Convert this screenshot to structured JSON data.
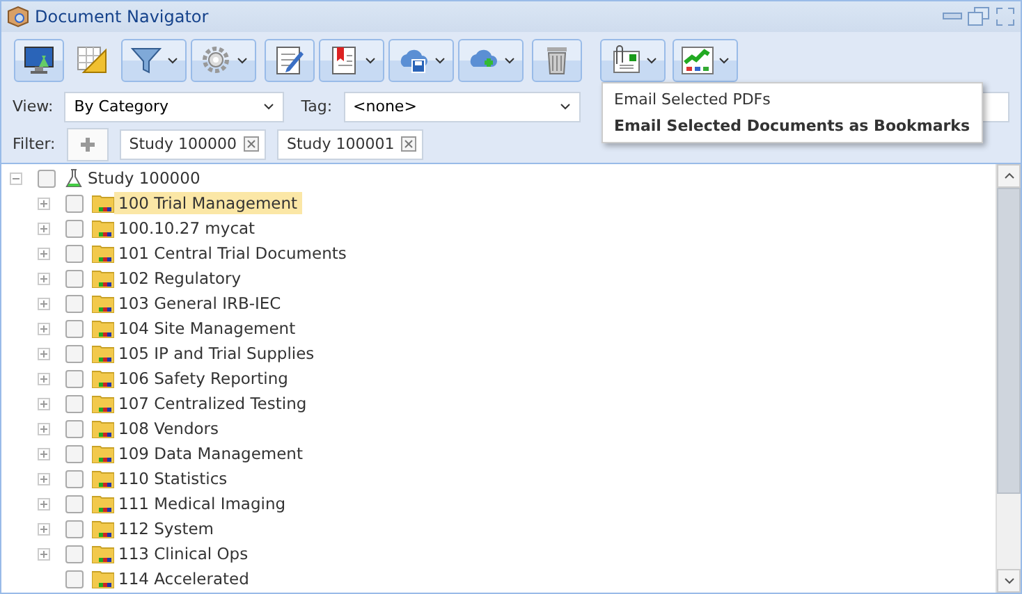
{
  "window": {
    "title": "Document Navigator"
  },
  "toolbar": [
    {
      "kind": "monitor",
      "dropdown": false,
      "pressed": true
    },
    {
      "kind": "ruler",
      "dropdown": false,
      "pressed": false
    },
    {
      "kind": "filter",
      "dropdown": true,
      "pressed": true
    },
    {
      "kind": "gear",
      "dropdown": true,
      "pressed": true
    },
    {
      "kind": "edit",
      "dropdown": false,
      "pressed": true
    },
    {
      "kind": "bookmark",
      "dropdown": true,
      "pressed": true
    },
    {
      "kind": "cloud-save",
      "dropdown": true,
      "pressed": true
    },
    {
      "kind": "cloud-add",
      "dropdown": true,
      "pressed": true
    },
    {
      "kind": "trash",
      "dropdown": false,
      "pressed": true
    },
    {
      "kind": "email",
      "dropdown": true,
      "pressed": true
    },
    {
      "kind": "chart",
      "dropdown": true,
      "pressed": true
    }
  ],
  "view": {
    "label": "View:",
    "value": "By Category"
  },
  "tag": {
    "label": "Tag:",
    "value": "<none>"
  },
  "filter": {
    "label": "Filter:",
    "chips": [
      "Study 100000",
      "Study 100001"
    ]
  },
  "menu": [
    {
      "label": "Email Selected PDFs",
      "bold": false
    },
    {
      "label": "Email Selected Documents as Bookmarks",
      "bold": true
    }
  ],
  "tree": [
    {
      "label": "Study 100000",
      "expanded": true,
      "checked": false,
      "selected": false,
      "children": [
        {
          "label": "100 Trial Management",
          "expandable": true,
          "checked": false,
          "selected": true
        },
        {
          "label": "100.10.27 mycat",
          "expandable": true,
          "checked": false,
          "selected": false
        },
        {
          "label": "101 Central Trial Documents",
          "expandable": true,
          "checked": false,
          "selected": false
        },
        {
          "label": "102 Regulatory",
          "expandable": true,
          "checked": false,
          "selected": false
        },
        {
          "label": "103 General IRB-IEC",
          "expandable": true,
          "checked": false,
          "selected": false
        },
        {
          "label": "104 Site Management",
          "expandable": true,
          "checked": false,
          "selected": false
        },
        {
          "label": "105 IP and Trial Supplies",
          "expandable": true,
          "checked": false,
          "selected": false
        },
        {
          "label": "106 Safety Reporting",
          "expandable": true,
          "checked": false,
          "selected": false
        },
        {
          "label": "107 Centralized Testing",
          "expandable": true,
          "checked": false,
          "selected": false
        },
        {
          "label": "108 Vendors",
          "expandable": true,
          "checked": false,
          "selected": false
        },
        {
          "label": "109 Data Management",
          "expandable": true,
          "checked": false,
          "selected": false
        },
        {
          "label": "110 Statistics",
          "expandable": true,
          "checked": false,
          "selected": false
        },
        {
          "label": "111 Medical Imaging",
          "expandable": true,
          "checked": false,
          "selected": false
        },
        {
          "label": "112 System",
          "expandable": true,
          "checked": false,
          "selected": false
        },
        {
          "label": "113 Clinical Ops",
          "expandable": true,
          "checked": false,
          "selected": false
        },
        {
          "label": "114 Accelerated",
          "expandable": false,
          "checked": false,
          "selected": false
        }
      ]
    }
  ]
}
